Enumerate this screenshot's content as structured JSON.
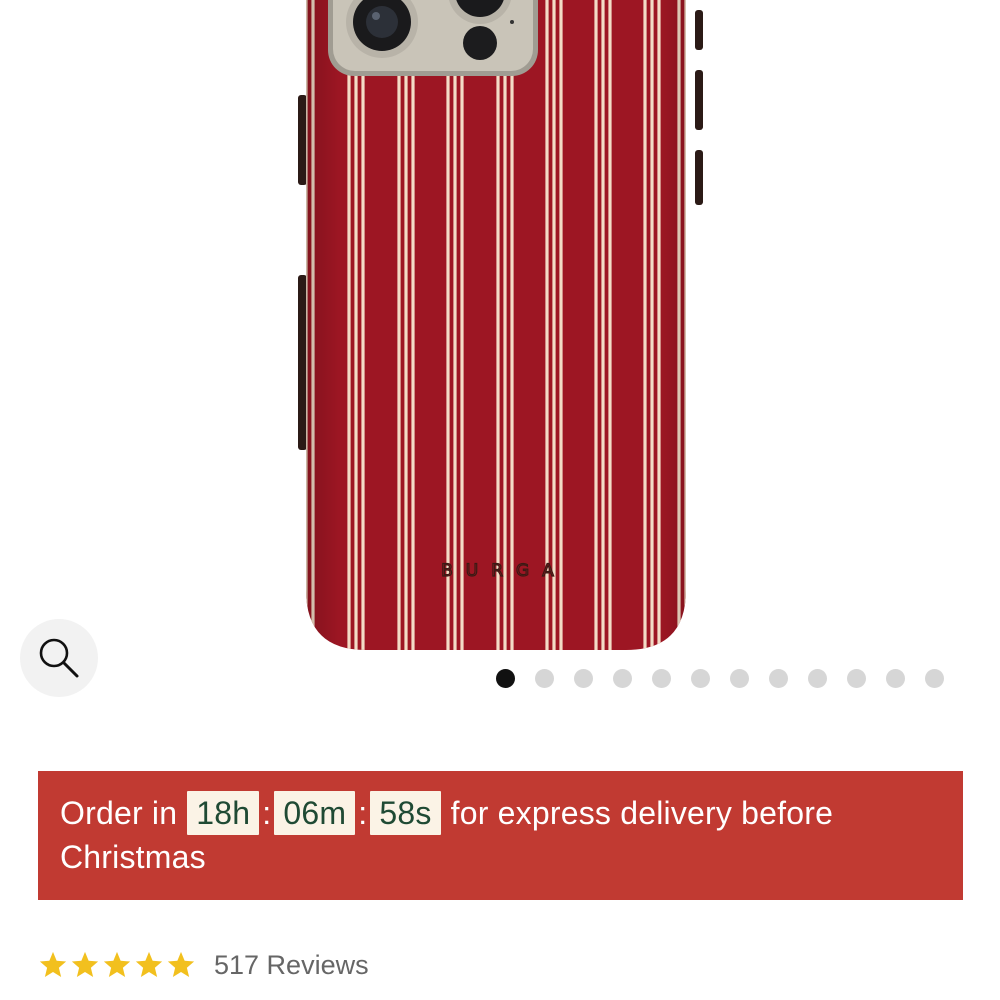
{
  "colors": {
    "case_red": "#9d1623",
    "case_red_dark": "#7f0f1b",
    "stripe_cream": "#f3dcc6",
    "banner_bg": "#c13a32",
    "timer_text": "#1f4a34",
    "star": "#f2c01e",
    "dot_active": "#111111",
    "dot_inactive": "#d6d6d6"
  },
  "gallery": {
    "product_brand_mark": "BURGA",
    "image_count": 12,
    "active_index": 0,
    "zoom_icon": "search-icon"
  },
  "delivery_banner": {
    "prefix": "Order in",
    "hours": "18h",
    "minutes": "06m",
    "seconds": "58s",
    "separator": ":",
    "suffix": "for express delivery before Christmas"
  },
  "reviews": {
    "rating": 5,
    "max_rating": 5,
    "label": "517 Reviews"
  }
}
